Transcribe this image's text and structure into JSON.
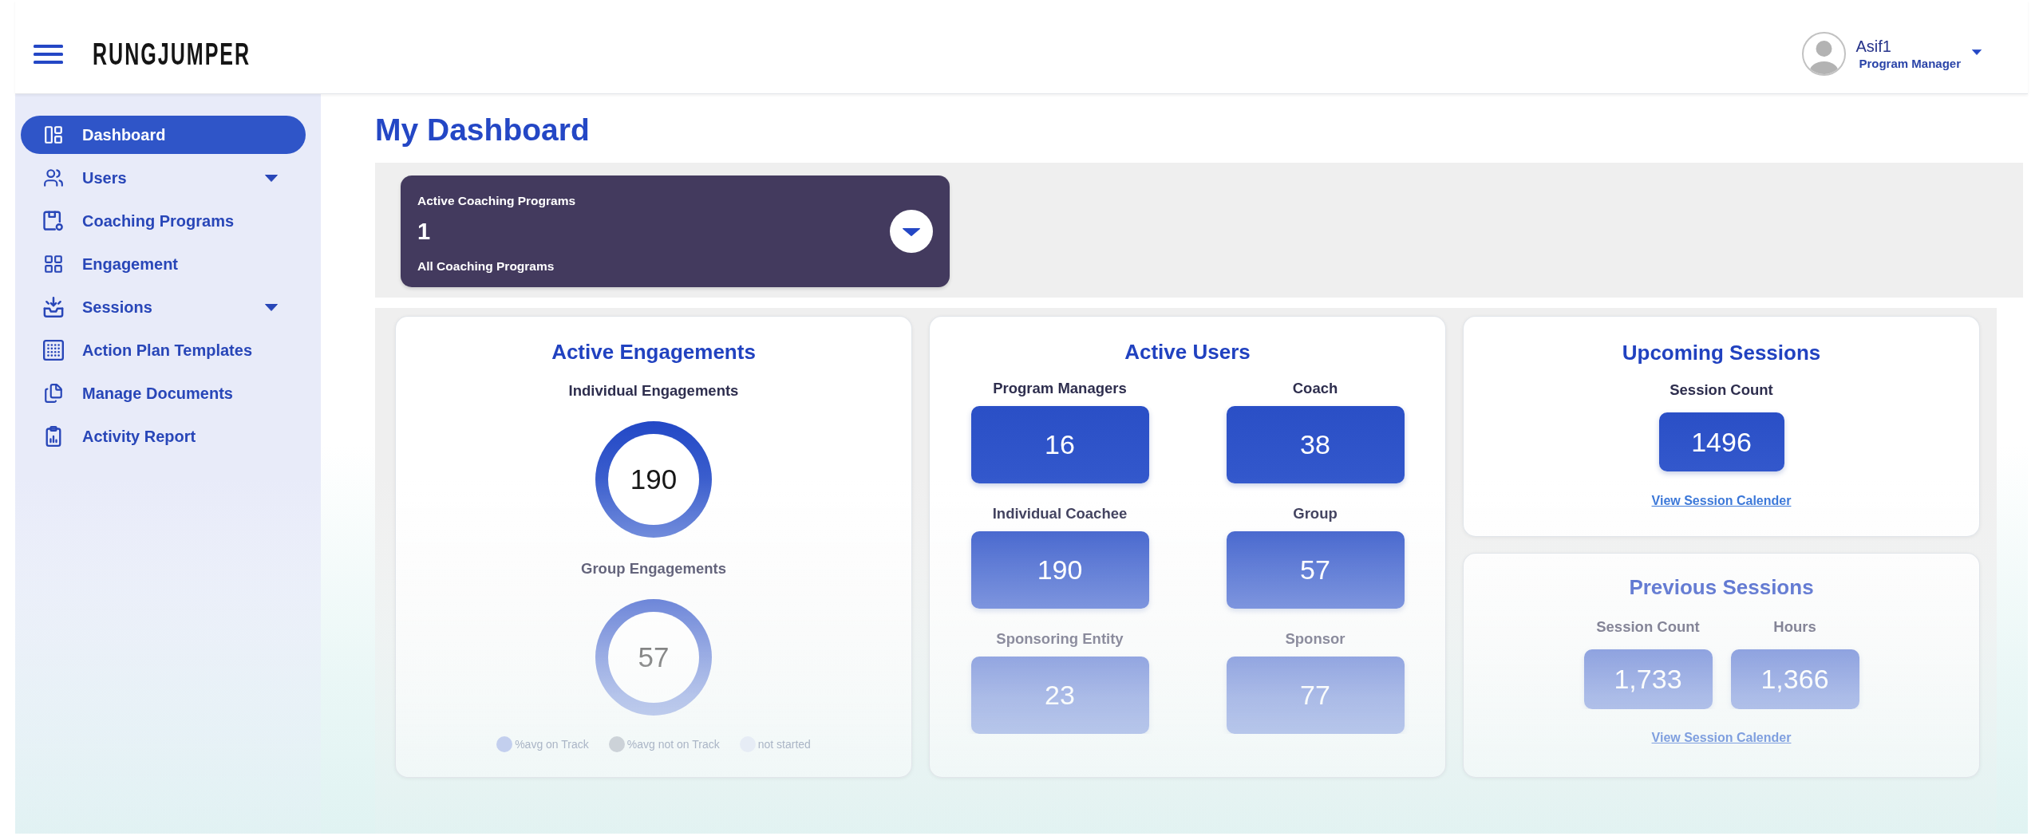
{
  "header": {
    "logo": "RUNGJUMPER",
    "user": {
      "name": "Asif1",
      "role": "Program Manager"
    }
  },
  "sidebar": {
    "items": [
      {
        "label": "Dashboard",
        "kind": "link",
        "selected": true
      },
      {
        "label": "Users",
        "kind": "menu",
        "selected": false
      },
      {
        "label": "Coaching Programs",
        "kind": "link",
        "selected": false
      },
      {
        "label": "Engagement",
        "kind": "link",
        "selected": false
      },
      {
        "label": "Sessions",
        "kind": "menu",
        "selected": false
      },
      {
        "label": "Action Plan Templates",
        "kind": "link",
        "selected": false
      },
      {
        "label": "Manage Documents",
        "kind": "link",
        "selected": false
      },
      {
        "label": "Activity Report",
        "kind": "link",
        "selected": false
      }
    ]
  },
  "page_title": "My Dashboard",
  "program_filter": {
    "label": "Active Coaching Programs",
    "value": "1",
    "scope": "All Coaching Programs"
  },
  "active_engagements": {
    "title": "Active Engagements",
    "rings": [
      {
        "label": "Individual Engagements",
        "value": "190"
      },
      {
        "label": "Group Engagements",
        "value": "57"
      }
    ],
    "legend": [
      {
        "label": "%avg on Track",
        "color": "#c3cfee"
      },
      {
        "label": "%avg not on Track",
        "color": "#ccd2d8"
      },
      {
        "label": "not started",
        "color": "#e6ecf5"
      }
    ]
  },
  "active_users": {
    "title": "Active Users",
    "stats": [
      {
        "label": "Program Managers",
        "value": "16"
      },
      {
        "label": "Coach",
        "value": "38"
      },
      {
        "label": "Individual Coachee",
        "value": "190"
      },
      {
        "label": "Group",
        "value": "57"
      },
      {
        "label": "Sponsoring Entity",
        "value": "23"
      },
      {
        "label": "Sponsor",
        "value": "77"
      }
    ]
  },
  "upcoming_sessions": {
    "title": "Upcoming Sessions",
    "stats": [
      {
        "label": "Session Count",
        "value": "1496"
      }
    ],
    "link": "View Session Calender"
  },
  "previous_sessions": {
    "title": "Previous Sessions",
    "stats": [
      {
        "label": "Session Count",
        "value": "1,733"
      },
      {
        "label": "Hours",
        "value": "1,366"
      }
    ],
    "link": "View Session Calender"
  }
}
